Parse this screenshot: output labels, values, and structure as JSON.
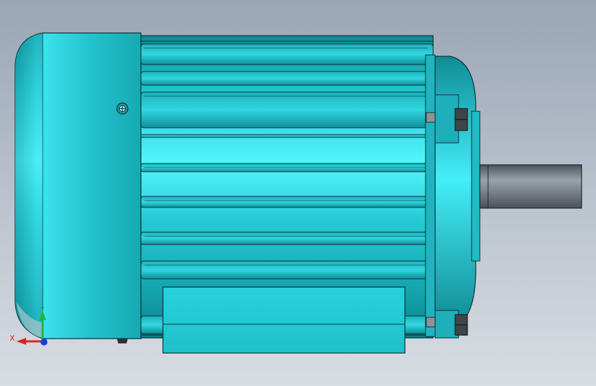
{
  "viewport": {
    "background_top": "#9aa6b6",
    "background_bottom": "#d8dde3"
  },
  "model": {
    "body_color": "#1fb9c4",
    "highlight_color": "#4cf4ff",
    "shaft_color": "#6f7880",
    "edge_color": "#0d2b2e"
  },
  "triad": {
    "x_label": "X",
    "y_label": "Y",
    "x_color": "#e0201a",
    "y_color": "#21b24a",
    "z_color": "#1a3fd6"
  }
}
